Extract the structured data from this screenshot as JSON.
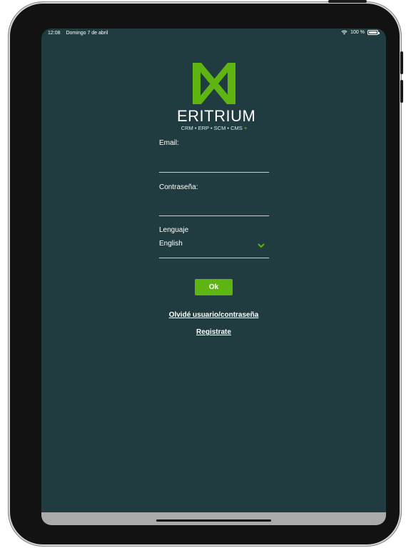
{
  "status_bar": {
    "time": "12:08",
    "date": "Domingo 7 de abril",
    "battery": "100 %"
  },
  "brand": {
    "name": "ERITRIUM",
    "tagline": "CRM • ERP • SCM • CMS",
    "tagline_plus": "+",
    "accent_color": "#5eb512",
    "background_color": "#213c40"
  },
  "form": {
    "email_label": "Email:",
    "email_value": "",
    "password_label": "Contraseña:",
    "password_value": "",
    "language_label": "Lenguaje",
    "language_value": "English"
  },
  "actions": {
    "ok_label": "Ok",
    "forgot_label": "Olvidé usuario/contraseña",
    "register_label": "Registrate"
  }
}
